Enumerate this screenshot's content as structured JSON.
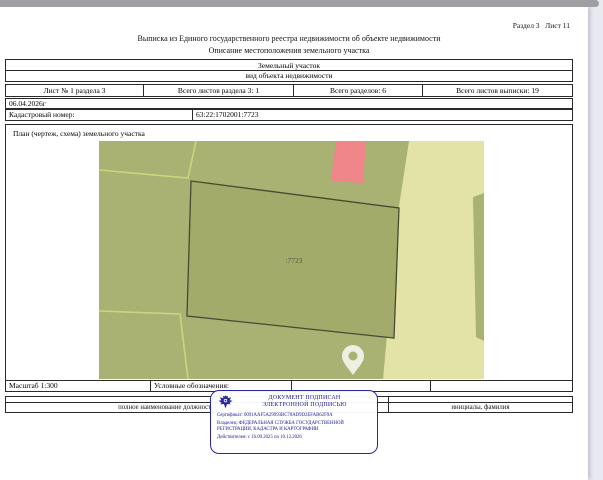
{
  "page": {
    "section_label": "Раздел 3   Лист 11",
    "title1": "Выписка из Единого государственного реестра недвижимости об объекте недвижимости",
    "title2": "Описание местоположения земельного участка"
  },
  "object": {
    "kind": "Земельный участок",
    "kind_caption": "вид объекта недвижимости",
    "sheet_info": [
      "Лист № 1 раздела 3",
      "Всего листов раздела 3: 1",
      "Всего разделов: 6",
      "Всего листов выписки: 19"
    ],
    "date": "06.04.2026г",
    "cadastral_label": "Кадастровый номер:",
    "cadastral_number": "63:22:1702001:7723"
  },
  "plan": {
    "title": "План (чертеж, схема) земельного участка",
    "scale": "Масштаб 1:300",
    "legend_label": "Условные обозначения:",
    "parcel_label": ":7723",
    "colors": {
      "land": "#a9b173",
      "parcel_fill": "#a3ab6b",
      "parcel_border": "#454b31",
      "zone_light": "#e3e3a7",
      "line_light": "#cbd67c",
      "highlight_pink": "#f0858a",
      "pin": "#ffffff",
      "label_text": "#55554a"
    }
  },
  "signature": {
    "position_caption": "полное наименование должности",
    "name_caption": "инициалы, фамилия",
    "stamp": {
      "line1": "ДОКУМЕНТ ПОДПИСАН",
      "line2": "ЭЛЕКТРОННОЙ ПОДПИСЬЮ",
      "certificate": "Сертификат: 0091AAF5A29993BC78AD9D2EFAB62F9A",
      "owner": "Владелец: ФЕДЕРАЛЬНАЯ СЛУЖБА ГОСУДАРСТВЕННОЙ РЕГИСТРАЦИИ, КАДАСТРА И КАРТОГРАФИИ",
      "validity": "Действителен: с 16.09.2025 по 10.12.2026",
      "color": "#17178e"
    }
  }
}
